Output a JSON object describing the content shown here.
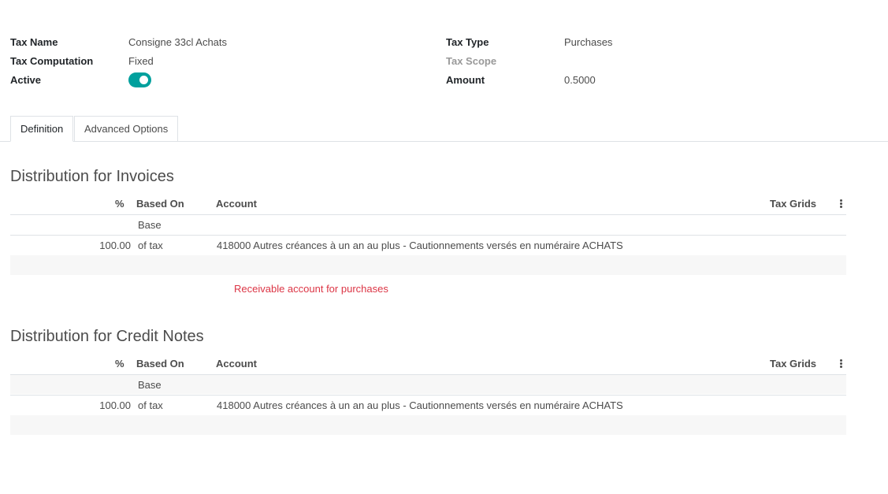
{
  "form": {
    "tax_name_label": "Tax Name",
    "tax_name_value": "Consigne 33cl Achats",
    "tax_computation_label": "Tax Computation",
    "tax_computation_value": "Fixed",
    "active_label": "Active",
    "active_value": true,
    "tax_type_label": "Tax Type",
    "tax_type_value": "Purchases",
    "tax_scope_label": "Tax Scope",
    "tax_scope_value": "",
    "amount_label": "Amount",
    "amount_value": "0.5000"
  },
  "tabs": [
    {
      "label": "Definition",
      "active": true
    },
    {
      "label": "Advanced Options",
      "active": false
    }
  ],
  "invoices": {
    "title": "Distribution for Invoices",
    "columns": [
      "%",
      "Based On",
      "Account",
      "Tax Grids"
    ],
    "rows": [
      {
        "percent": "",
        "based_on": "Base",
        "account": "",
        "tax_grids": ""
      },
      {
        "percent": "100.00",
        "based_on": "of tax",
        "account": "418000 Autres créances à un an au plus - Cautionnements versés en numéraire ACHATS",
        "tax_grids": ""
      }
    ],
    "help_text": "Receivable account for purchases"
  },
  "credit_notes": {
    "title": "Distribution for Credit Notes",
    "columns": [
      "%",
      "Based On",
      "Account",
      "Tax Grids"
    ],
    "rows": [
      {
        "percent": "",
        "based_on": "Base",
        "account": "",
        "tax_grids": ""
      },
      {
        "percent": "100.00",
        "based_on": "of tax",
        "account": "418000 Autres créances à un an au plus - Cautionnements versés en numéraire ACHATS",
        "tax_grids": ""
      }
    ]
  },
  "colors": {
    "toggle_on": "#00a09d",
    "warning_text": "#dc3545"
  },
  "icons": {
    "column_options": "vertical-ellipsis-icon"
  }
}
